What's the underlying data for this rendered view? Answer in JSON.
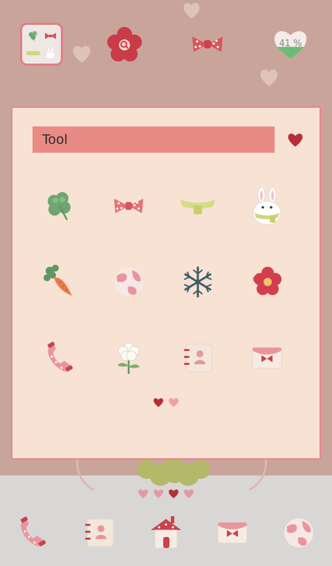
{
  "app": {
    "accent_color": "#ea8a84",
    "panel_color": "#f7e2d3",
    "wall_color": "#c9a49b"
  },
  "top_row": {
    "items": [
      {
        "name": "folder-shortcut",
        "icon": "folder-icon"
      },
      {
        "name": "search-flower",
        "icon": "flower-search-icon"
      },
      {
        "name": "bow",
        "icon": "bow-icon"
      },
      {
        "name": "battery-widget",
        "icon": "heart-battery-icon"
      }
    ],
    "battery_level": "41 %",
    "battery_fraction": 0.41
  },
  "folder": {
    "title": "Tool",
    "title_heart_icon": "heart-icon",
    "apps": [
      {
        "icon": "clover-icon"
      },
      {
        "icon": "bow-icon"
      },
      {
        "icon": "scarf-icon"
      },
      {
        "icon": "rabbit-icon"
      },
      {
        "icon": "carrot-icon"
      },
      {
        "icon": "pink-ball-icon"
      },
      {
        "icon": "snowflake-icon"
      },
      {
        "icon": "red-flower-icon"
      },
      {
        "icon": "phone-icon"
      },
      {
        "icon": "white-flower-icon"
      },
      {
        "icon": "contacts-book-icon"
      },
      {
        "icon": "envelope-icon"
      }
    ],
    "page_count": 2,
    "current_page": 1
  },
  "dock": {
    "page_count": 4,
    "current_page": 3,
    "items": [
      {
        "icon": "phone-icon"
      },
      {
        "icon": "contacts-book-icon"
      },
      {
        "icon": "house-icon"
      },
      {
        "icon": "envelope-icon"
      },
      {
        "icon": "pink-ball-icon"
      }
    ]
  }
}
